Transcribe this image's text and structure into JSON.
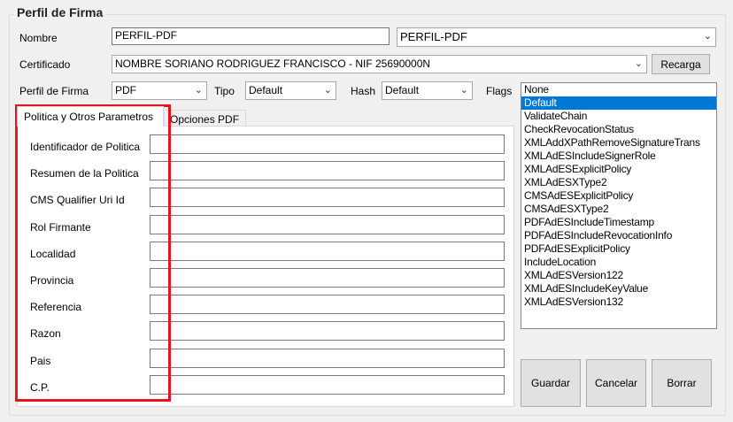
{
  "group_title": "Perfil de Firma",
  "nombre": {
    "label": "Nombre",
    "value": "PERFIL-PDF",
    "combo_value": "PERFIL-PDF"
  },
  "certificado": {
    "label": "Certificado",
    "value": "NOMBRE SORIANO RODRIGUEZ FRANCISCO - NIF 25690000N",
    "button_label": "Recarga"
  },
  "perfil": {
    "label": "Perfil de Firma",
    "value": "PDF",
    "tipo_label": "Tipo",
    "tipo_value": "Default",
    "hash_label": "Hash",
    "hash_value": "Default",
    "flags_label": "Flags"
  },
  "flags_items": [
    "None",
    "Default",
    "ValidateChain",
    "CheckRevocationStatus",
    "XMLAddXPathRemoveSignatureTrans",
    "XMLAdESIncludeSignerRole",
    "XMLAdESExplicitPolicy",
    "XMLAdESXType2",
    "CMSAdESExplicitPolicy",
    "CMSAdESXType2",
    "PDFAdESIncludeTimestamp",
    "PDFAdESIncludeRevocationInfo",
    "PDFAdESExplicitPolicy",
    "IncludeLocation",
    "XMLAdESVersion122",
    "XMLAdESIncludeKeyValue",
    "XMLAdESVersion132"
  ],
  "flags_selected": "Default",
  "tabs": [
    {
      "label": "Politica y Otros Parametros",
      "active": true
    },
    {
      "label": "Opciones PDF",
      "active": false
    }
  ],
  "fields": [
    {
      "label": "Identificador de Politica",
      "value": ""
    },
    {
      "label": "Resumen de la Politica",
      "value": ""
    },
    {
      "label": "CMS Qualifier Uri Id",
      "value": ""
    },
    {
      "label": "Rol Firmante",
      "value": ""
    },
    {
      "label": "Localidad",
      "value": ""
    },
    {
      "label": "Provincia",
      "value": ""
    },
    {
      "label": "Referencia",
      "value": ""
    },
    {
      "label": "Razon",
      "value": ""
    },
    {
      "label": "Pais",
      "value": ""
    },
    {
      "label": "C.P.",
      "value": ""
    }
  ],
  "buttons": {
    "guardar": "Guardar",
    "cancelar": "Cancelar",
    "borrar": "Borrar"
  },
  "colors": {
    "selection": "#0078d7",
    "highlight": "#e8141c"
  },
  "icons": {
    "dropdown": "chevron-down-icon"
  }
}
